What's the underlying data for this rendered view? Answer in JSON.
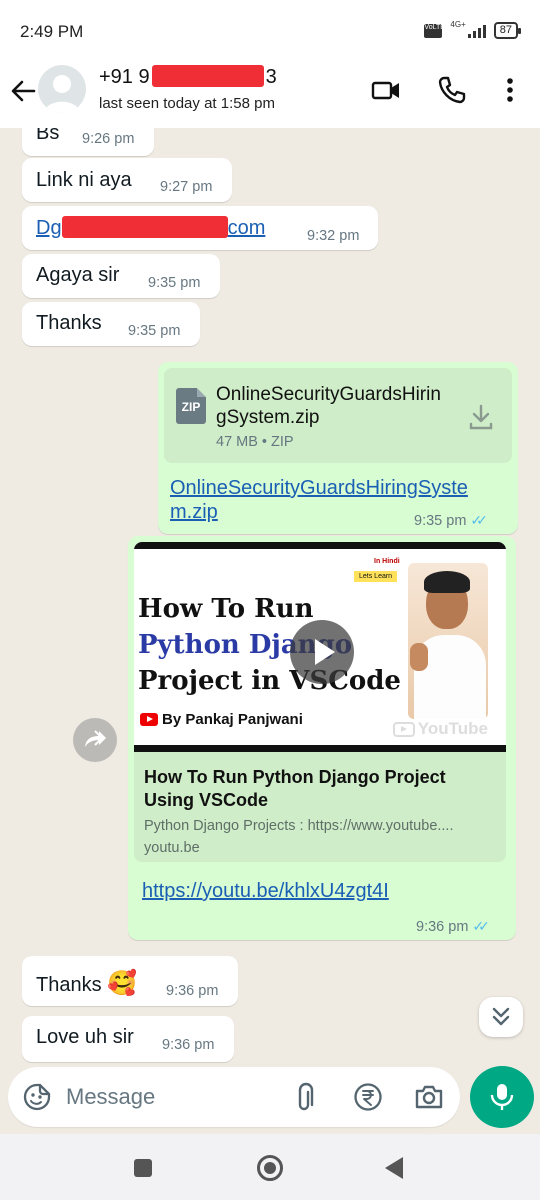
{
  "status_bar": {
    "time": "2:49 PM",
    "network": "4G+",
    "volte": "VoLTE",
    "battery": "87"
  },
  "header": {
    "contact_prefix": "+91 9",
    "contact_suffix": "3",
    "last_seen": "last seen today at 1:58 pm"
  },
  "messages": [
    {
      "dir": "in",
      "text": "Bs",
      "time": "9:26 pm"
    },
    {
      "dir": "in",
      "text": "Link ni aya",
      "time": "9:27 pm"
    },
    {
      "dir": "in",
      "link_start": "Dg",
      "link_end": "com",
      "time": "9:32 pm"
    },
    {
      "dir": "in",
      "text": "Agaya sir",
      "time": "9:35 pm"
    },
    {
      "dir": "in",
      "text": "Thanks",
      "time": "9:35 pm"
    },
    {
      "dir": "out",
      "file_name": "OnlineSecurityGuardsHiringSystem.zip",
      "file_meta": "47 MB • ZIP",
      "file_badge": "ZIP",
      "caption_line1": "OnlineSecurityGuardsHiringSyste",
      "caption_line2": "m.zip",
      "time": "9:35 pm"
    },
    {
      "dir": "out",
      "thumb_tag1": "In Hindi",
      "thumb_tag2": "Lets Learn",
      "thumb_line1": "How To Run",
      "thumb_line2": "Python Django",
      "thumb_line3": "Project in VSCode",
      "thumb_byline": "By Pankaj Panjwani",
      "thumb_brand": "YouTube",
      "preview_title": "How To Run Python Django Project Using VSCode",
      "preview_desc": "Python Django Projects : https://www.youtube....",
      "preview_domain": "youtu.be",
      "link": "https://youtu.be/khlxU4zgt4I",
      "time": "9:36 pm"
    },
    {
      "dir": "in",
      "text": "Thanks",
      "emoji": "🥰",
      "time": "9:36 pm"
    },
    {
      "dir": "in",
      "text": "Love uh sir",
      "time": "9:36 pm"
    }
  ],
  "read_ticks": "✓✓",
  "colors": {
    "outgoing": "#d9fdd3",
    "incoming": "#ffffff",
    "accent": "#00a884",
    "link": "#1a5fb4",
    "read_ticks": "#53bdeb",
    "redaction": "#ee1c25"
  },
  "composer": {
    "placeholder": "Message"
  },
  "icons": {
    "header": [
      "back-arrow-icon",
      "avatar-placeholder-icon",
      "video-call-icon",
      "voice-call-icon",
      "more-vertical-icon"
    ],
    "composer": [
      "emoji-sticker-icon",
      "attach-icon",
      "rupee-payment-icon",
      "camera-icon",
      "mic-icon"
    ],
    "chat": [
      "forward-icon",
      "scroll-down-icon",
      "download-icon",
      "zip-file-icon",
      "play-icon"
    ],
    "navigation": [
      "recents-icon",
      "home-icon",
      "back-icon"
    ]
  }
}
